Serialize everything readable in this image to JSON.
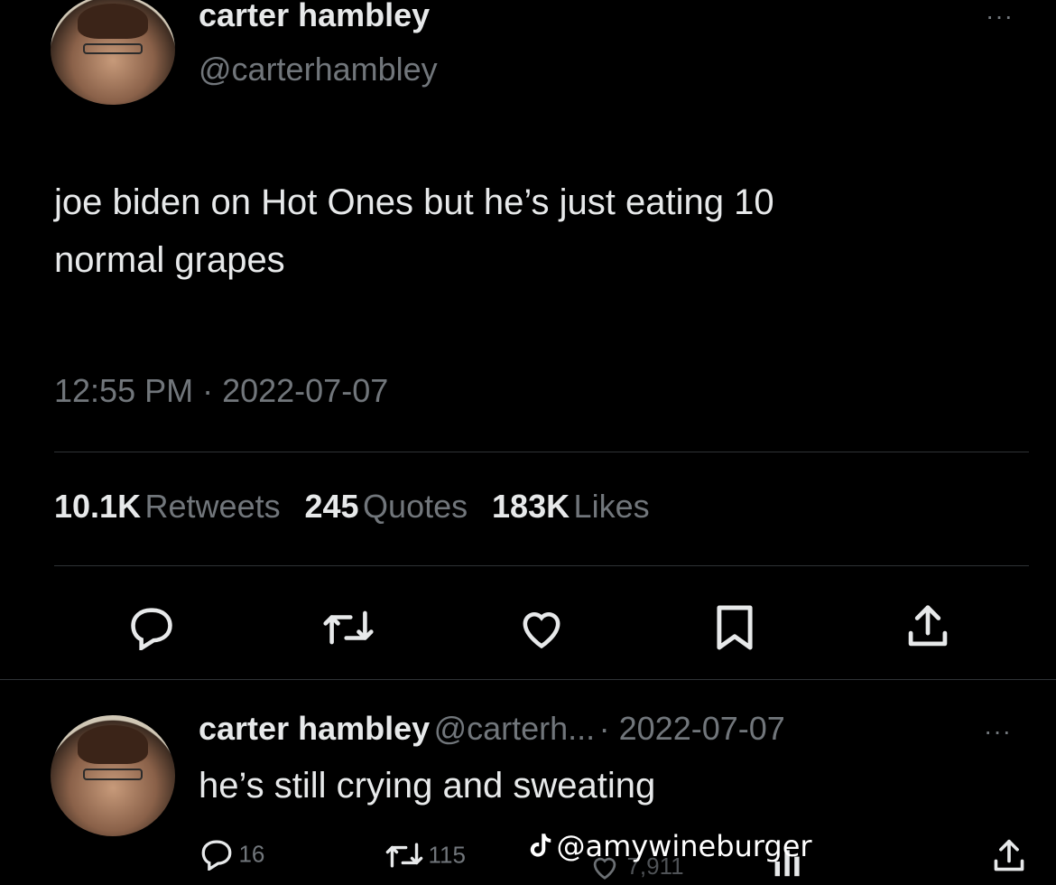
{
  "main_tweet": {
    "author_name": "carter hambley",
    "author_handle": "@carterhambley",
    "text_line1": "joe biden on Hot Ones but he’s just eating 10",
    "text_line2": "normal grapes",
    "timestamp": "12:55 PM · 2022-07-07",
    "stats": {
      "retweets_count": "10.1K",
      "retweets_label": "Retweets",
      "quotes_count": "245",
      "quotes_label": "Quotes",
      "likes_count": "183K",
      "likes_label": "Likes"
    },
    "more_label": "···"
  },
  "reply": {
    "author_name": "carter hambley",
    "author_handle": "@carterh...",
    "separator_date": "· 2022-07-07",
    "text": "he’s still crying and sweating",
    "more_label": "···",
    "reply_count": "16",
    "retweet_count": "115",
    "like_count_partial": "7,911"
  },
  "watermark": {
    "text": "@amywineburger"
  },
  "icons": {
    "reply": "reply-icon",
    "retweet": "retweet-icon",
    "like": "heart-icon",
    "bookmark": "bookmark-icon",
    "share": "share-icon",
    "views": "views-icon",
    "tiktok": "tiktok-logo-icon"
  }
}
